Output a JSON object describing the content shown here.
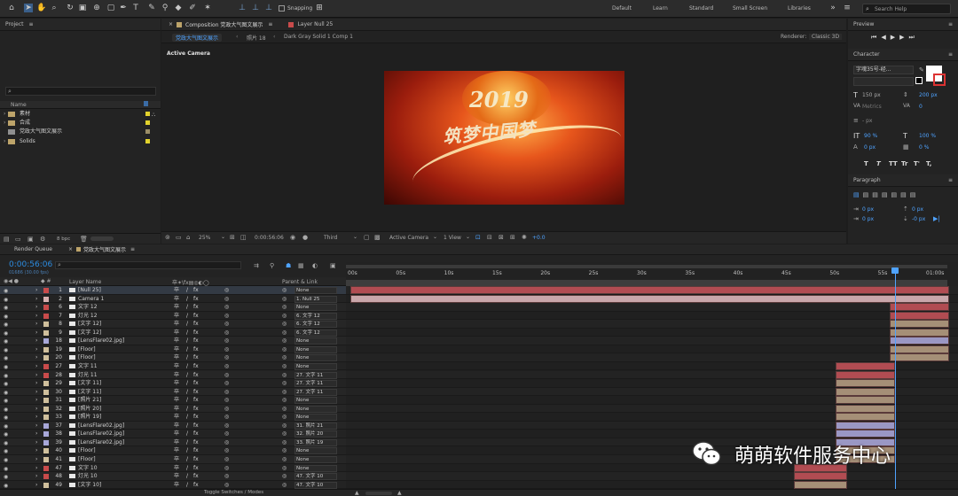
{
  "toolbar": {
    "snapping_label": "Snapping",
    "workspaces": [
      "Default",
      "Learn",
      "Standard",
      "Small Screen",
      "Libraries"
    ],
    "search_placeholder": "Search Help"
  },
  "project": {
    "panel_title": "Project",
    "column_name": "Name",
    "items": [
      "素材",
      "合成",
      "党政大气图文展示",
      "Solids"
    ],
    "bpc_label": "8 bpc"
  },
  "composition": {
    "tab_label": "Composition 党政大气图文展示",
    "layer_tab_label": "Layer Null 25",
    "breadcrumbs": [
      "党政大气图文展示",
      "照片 18",
      "Dark Gray Solid 1 Comp 1"
    ],
    "renderer_label": "Renderer:",
    "renderer_value": "Classic 3D",
    "view_label": "Active Camera",
    "preview_year": "2019",
    "preview_title": "筑梦中国梦",
    "zoom": "25%",
    "time": "0:00:56:06",
    "quality": "Third",
    "camera": "Active Camera",
    "views": "1 View",
    "exposure": "+0.0"
  },
  "preview_panel": {
    "title": "Preview"
  },
  "character": {
    "title": "Character",
    "font": "字魂35号-经...",
    "size": "150 px",
    "leading": "200 px",
    "tracking_label": "Metrics",
    "tracking_value": "0",
    "stroke": "- px",
    "vscale": "90 %",
    "hscale": "100 %",
    "baseline": "0 px",
    "tsume": "0 %",
    "styles": [
      "T",
      "T",
      "TT",
      "Tr",
      "T'",
      "T,"
    ]
  },
  "paragraph": {
    "title": "Paragraph",
    "indent": [
      "0 px",
      "0 px",
      "0 px",
      "-0 px",
      "0 px"
    ]
  },
  "timeline": {
    "render_queue": "Render Queue",
    "comp_tab": "党政大气图文展示",
    "current_time": "0:00:56:06",
    "fps_info": "01686 (30.00 fps)",
    "col_layer_name": "Layer Name",
    "col_parent": "Parent & Link",
    "ruler": [
      "00s",
      "05s",
      "10s",
      "15s",
      "20s",
      "25s",
      "30s",
      "35s",
      "40s",
      "45s",
      "50s",
      "55s",
      "01:00s"
    ],
    "toggle_label": "Toggle Switches / Modes",
    "layers": [
      {
        "num": "1",
        "name": "[Null 25]",
        "parent": "None",
        "label": "#c94b4b",
        "start": 0,
        "end": 1,
        "bar": "#b14c52"
      },
      {
        "num": "2",
        "name": "Camera 1",
        "parent": "1. Null 25",
        "label": "#d8b1b1",
        "start": 0,
        "end": 1,
        "bar": "#c9a6aa"
      },
      {
        "num": "6",
        "name": "文字 12",
        "parent": "None",
        "label": "#c94b4b",
        "start": 0.9,
        "end": 1,
        "bar": "#b14c52"
      },
      {
        "num": "7",
        "name": "灯光 12",
        "parent": "6. 文字 12",
        "label": "#c94b4b",
        "start": 0.9,
        "end": 1,
        "bar": "#b14c52"
      },
      {
        "num": "8",
        "name": "[文字 12]",
        "parent": "6. 文字 12",
        "label": "#cfbf9c",
        "start": 0.9,
        "end": 1,
        "bar": "#a58f77"
      },
      {
        "num": "9",
        "name": "[文字 12]",
        "parent": "6. 文字 12",
        "label": "#cfbf9c",
        "start": 0.9,
        "end": 1,
        "bar": "#a58f77"
      },
      {
        "num": "18",
        "name": "[LensFlare02.jpg]",
        "parent": "None",
        "label": "#a7a7d8",
        "start": 0.9,
        "end": 1,
        "bar": "#9a97c4"
      },
      {
        "num": "19",
        "name": "[Floor]",
        "parent": "None",
        "label": "#cfbf9c",
        "start": 0.9,
        "end": 1,
        "bar": "#a58f77"
      },
      {
        "num": "20",
        "name": "[Floor]",
        "parent": "None",
        "label": "#cfbf9c",
        "start": 0.9,
        "end": 1,
        "bar": "#a58f77"
      },
      {
        "num": "27",
        "name": "文字 11",
        "parent": "None",
        "label": "#c94b4b",
        "start": 0.81,
        "end": 0.91,
        "bar": "#b14c52"
      },
      {
        "num": "28",
        "name": "灯光 11",
        "parent": "27. 文字 11",
        "label": "#c94b4b",
        "start": 0.81,
        "end": 0.91,
        "bar": "#b14c52"
      },
      {
        "num": "29",
        "name": "[文字 11]",
        "parent": "27. 文字 11",
        "label": "#cfbf9c",
        "start": 0.81,
        "end": 0.91,
        "bar": "#a58f77"
      },
      {
        "num": "30",
        "name": "[文字 11]",
        "parent": "27. 文字 11",
        "label": "#cfbf9c",
        "start": 0.81,
        "end": 0.91,
        "bar": "#a58f77"
      },
      {
        "num": "31",
        "name": "[照片 21]",
        "parent": "None",
        "label": "#cfbf9c",
        "start": 0.81,
        "end": 0.91,
        "bar": "#a58f77"
      },
      {
        "num": "32",
        "name": "[照片 20]",
        "parent": "None",
        "label": "#cfbf9c",
        "start": 0.81,
        "end": 0.91,
        "bar": "#a58f77"
      },
      {
        "num": "33",
        "name": "[照片 19]",
        "parent": "None",
        "label": "#cfbf9c",
        "start": 0.81,
        "end": 0.91,
        "bar": "#a58f77"
      },
      {
        "num": "37",
        "name": "[LensFlare02.jpg]",
        "parent": "31. 照片 21",
        "label": "#a7a7d8",
        "start": 0.81,
        "end": 0.91,
        "bar": "#9a97c4"
      },
      {
        "num": "38",
        "name": "[LensFlare02.jpg]",
        "parent": "32. 照片 20",
        "label": "#a7a7d8",
        "start": 0.81,
        "end": 0.91,
        "bar": "#9a97c4"
      },
      {
        "num": "39",
        "name": "[LensFlare02.jpg]",
        "parent": "33. 照片 19",
        "label": "#a7a7d8",
        "start": 0.81,
        "end": 0.91,
        "bar": "#9a97c4"
      },
      {
        "num": "40",
        "name": "[Floor]",
        "parent": "None",
        "label": "#cfbf9c",
        "start": 0.81,
        "end": 0.91,
        "bar": "#a58f77"
      },
      {
        "num": "41",
        "name": "[Floor]",
        "parent": "None",
        "label": "#cfbf9c",
        "start": 0.81,
        "end": 0.91,
        "bar": "#a58f77"
      },
      {
        "num": "47",
        "name": "文字 10",
        "parent": "None",
        "label": "#c94b4b",
        "start": 0.74,
        "end": 0.83,
        "bar": "#b14c52"
      },
      {
        "num": "48",
        "name": "灯光 10",
        "parent": "47. 文字 10",
        "label": "#c94b4b",
        "start": 0.74,
        "end": 0.83,
        "bar": "#b14c52"
      },
      {
        "num": "49",
        "name": "[文字 10]",
        "parent": "47. 文字 10",
        "label": "#cfbf9c",
        "start": 0.74,
        "end": 0.83,
        "bar": "#a58f77"
      }
    ]
  },
  "watermark": {
    "text": "萌萌软件服务中心"
  }
}
